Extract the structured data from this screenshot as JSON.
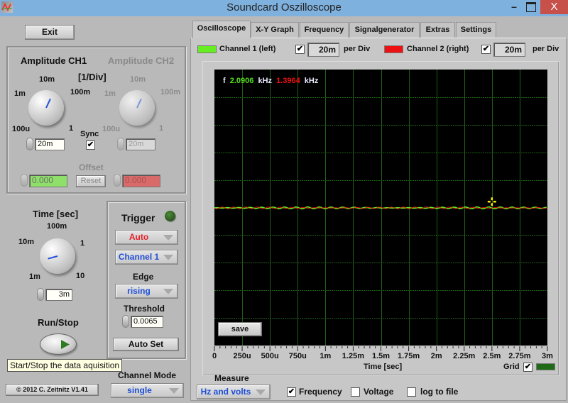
{
  "window": {
    "title": "Soundcard Oszilloscope",
    "minimize": "–",
    "close": "X"
  },
  "left": {
    "exit_label": "Exit",
    "amplitude": {
      "ch1_title": "Amplitude CH1",
      "ch2_title": "Amplitude CH2",
      "unit_label": "[1/Div]",
      "scale_labels": [
        "100u",
        "1m",
        "10m",
        "100m",
        "1"
      ],
      "ch1_value": "20m",
      "ch2_value": "20m",
      "sync_label": "Sync",
      "sync_checked": true,
      "offset_label": "Offset",
      "offset_ch1": "0.000",
      "offset_ch2": "0.000",
      "reset_label": "Reset"
    },
    "time": {
      "title": "Time [sec]",
      "scale_labels": [
        "1m",
        "10m",
        "100m",
        "1",
        "10"
      ],
      "value": "3m"
    },
    "trigger": {
      "title": "Trigger",
      "mode": "Auto",
      "channel": "Channel 1",
      "edge_label": "Edge",
      "edge": "rising",
      "threshold_label": "Threshold",
      "threshold": "0.0065",
      "autoset_label": "Auto Set"
    },
    "run_stop_label": "Run/Stop",
    "tooltip": "Start/Stop the data aquisition",
    "copyright": "© 2012  C. Zeitnitz V1.41",
    "channel_mode_label": "Channel Mode",
    "channel_mode": "single"
  },
  "tabs": [
    {
      "label": "Oscilloscope",
      "active": true
    },
    {
      "label": "X-Y Graph",
      "active": false
    },
    {
      "label": "Frequency",
      "active": false
    },
    {
      "label": "Signalgenerator",
      "active": false
    },
    {
      "label": "Extras",
      "active": false
    },
    {
      "label": "Settings",
      "active": false
    }
  ],
  "channels": {
    "ch1_label": "Channel 1 (left)",
    "ch1_color": "#66ee22",
    "ch1_enabled": true,
    "ch1_per_div": "20m",
    "ch2_label": "Channel 2 (right)",
    "ch2_color": "#ee1111",
    "ch2_enabled": true,
    "ch2_per_div": "20m",
    "per_div_label": "per Div"
  },
  "plot": {
    "freq_prefix": "f",
    "freq_ch1": "2.0906",
    "freq_ch2": "1.3964",
    "freq_unit": "kHz",
    "save_label": "save",
    "xlabel": "Time [sec]",
    "x_ticks": [
      "0",
      "250u",
      "500u",
      "750u",
      "1m",
      "1.25m",
      "1.5m",
      "1.75m",
      "2m",
      "2.25m",
      "2.5m",
      "2.75m",
      "3m"
    ],
    "grid_label": "Grid",
    "grid_checked": true,
    "grid_color": "#1f5f16"
  },
  "chart_data": {
    "type": "line",
    "title": "",
    "xlabel": "Time [sec]",
    "ylabel": "",
    "xlim": [
      0,
      0.003
    ],
    "ylim": [
      -5,
      5
    ],
    "grid": true,
    "x_divisions": 12,
    "y_divisions": 10,
    "series": [
      {
        "name": "Channel 1 (left)",
        "color": "#66ee22",
        "description": "flat trace near 0",
        "values_level_div": 0
      },
      {
        "name": "Channel 2 (right)",
        "color": "#ee1111",
        "description": "flat trace near 0",
        "values_level_div": 0
      }
    ],
    "cursor": {
      "x": "2.5m",
      "y_div": 0.2
    }
  },
  "measure": {
    "title": "Measure",
    "mode": "Hz and volts",
    "frequency_label": "Frequency",
    "frequency_checked": true,
    "voltage_label": "Voltage",
    "voltage_checked": false,
    "log_label": "log to file",
    "log_checked": false
  }
}
